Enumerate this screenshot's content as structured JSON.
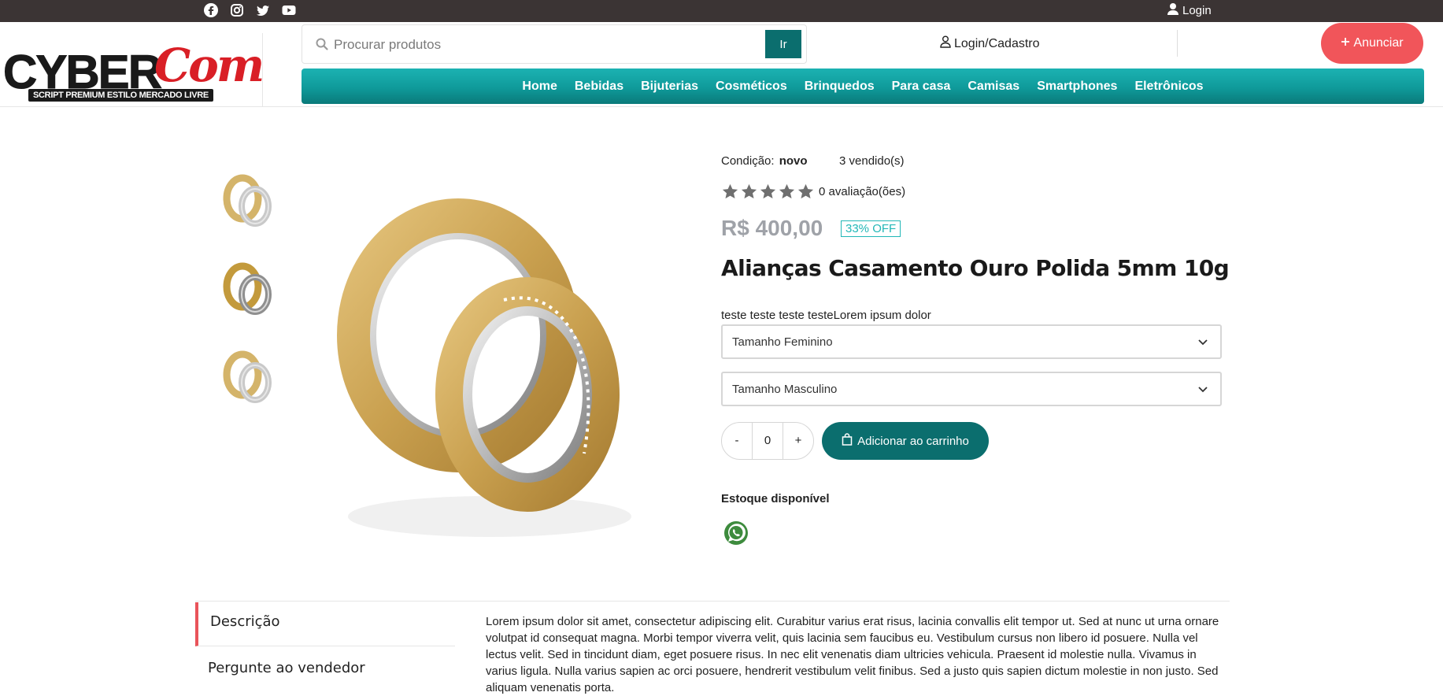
{
  "topbar": {
    "social": [
      "facebook-icon",
      "instagram-icon",
      "twitter-icon",
      "youtube-icon"
    ],
    "login_label": "Login"
  },
  "logo": {
    "word1": "CYBER",
    "word2": "Com",
    "tagline": "SCRIPT PREMIUM ESTILO MERCADO LIVRE"
  },
  "search": {
    "placeholder": "Procurar produtos",
    "button_label": "Ir"
  },
  "header": {
    "login_label": "Login/Cadastro",
    "anunciar_label": "Anunciar"
  },
  "nav": {
    "items": [
      "Home",
      "Bebidas",
      "Bijuterias",
      "Cosméticos",
      "Brinquedos",
      "Para casa",
      "Camisas",
      "Smartphones",
      "Eletrônicos"
    ]
  },
  "product": {
    "condition_label": "Condição:",
    "condition_value": "novo",
    "sold": "3 vendido(s)",
    "rating_text": "0 avaliação(ões)",
    "price": "R$ 400,00",
    "discount": "33% OFF",
    "title": "Alianças Casamento Ouro Polida 5mm 10g",
    "short_description": "teste teste teste testeLorem ipsum dolor",
    "select_female": "Tamanho Feminino",
    "select_male": "Tamanho Masculino",
    "qty_minus": "-",
    "qty_value": "0",
    "qty_plus": "+",
    "add_to_cart": "Adicionar ao carrinho",
    "stock": "Estoque disponível"
  },
  "tabs": {
    "description": "Descrição",
    "ask_seller": "Pergunte ao vendedor"
  },
  "description_text": "Lorem ipsum dolor sit amet, consectetur adipiscing elit. Curabitur varius erat risus, lacinia convallis elit tempor ut. Sed at nunc ut urna ornare volutpat id consequat magna. Morbi tempor viverra velit, quis lacinia sem faucibus eu. Vestibulum cursus non libero id posuere. Nulla vel lectus velit. Sed in tincidunt diam, eget posuere risus. In nec elit venenatis diam ultricies vehicula. Praesent id molestie nulla. Vivamus in varius ligula. Nulla varius sapien ac orci posuere, hendrerit vestibulum velit finibus. Sed a justo quis sapien dictum molestie in non justo. Sed aliquam venenatis porta."
}
